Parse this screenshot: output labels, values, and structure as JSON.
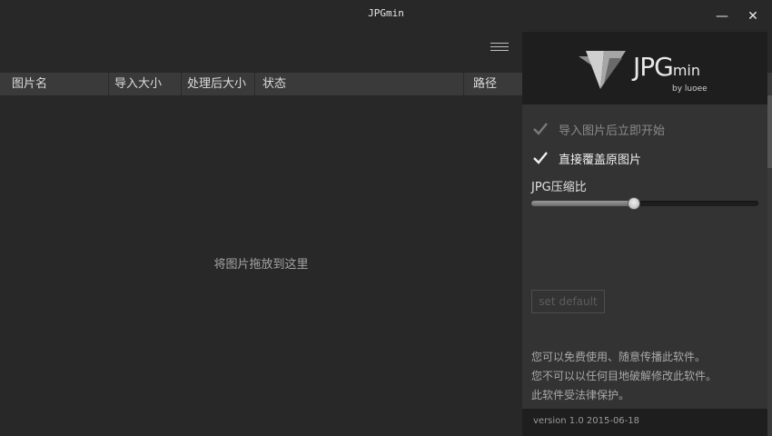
{
  "app": {
    "title": "JPGmin"
  },
  "window": {
    "minimize_glyph": "—",
    "close_glyph": "✕"
  },
  "table": {
    "columns": [
      "图片名",
      "导入大小",
      "处理后大小",
      "状态",
      "路径"
    ],
    "empty_hint": "将图片拖放到这里"
  },
  "panel": {
    "logo": {
      "main": "JPG",
      "suffix": "min",
      "byline": "by luoee"
    },
    "options": [
      {
        "label": "导入图片后立即开始",
        "checked": true,
        "enabled": false
      },
      {
        "label": "直接覆盖原图片",
        "checked": true,
        "enabled": true
      }
    ],
    "quality": {
      "label": "JPG压缩比",
      "value": 45
    },
    "set_default_label": "set default",
    "info_lines": [
      "您可以免费使用、随意传播此软件。",
      "您不可以以任何目地破解修改此软件。",
      "此软件受法律保护。"
    ],
    "version": "version 1.0 2015-06-18"
  },
  "icons": {
    "menu": "hamburger-menu-icon",
    "check": "check-icon",
    "logo": "jpgmin-logo-icon"
  },
  "colors": {
    "background": "#282828",
    "panel": "#333333",
    "header": "#3a3a3a",
    "logo_bg": "#1e1e1e"
  }
}
